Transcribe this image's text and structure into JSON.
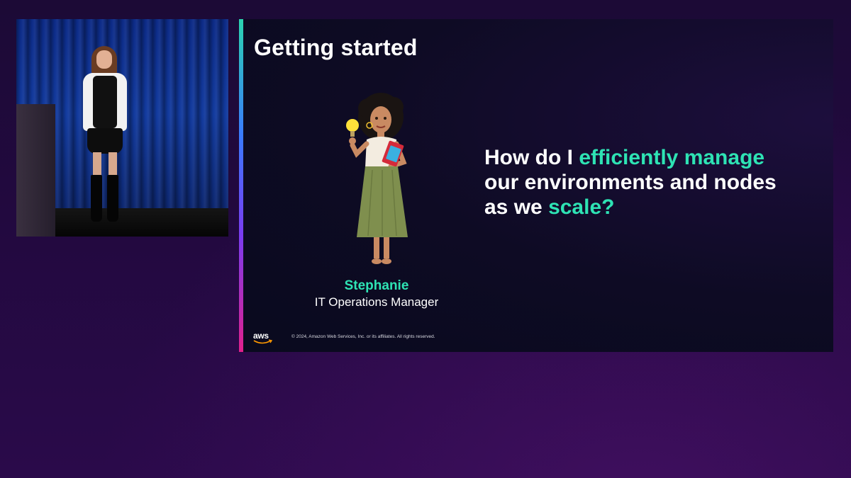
{
  "slide": {
    "title": "Getting started",
    "persona": {
      "name": "Stephanie",
      "role": "IT Operations Manager"
    },
    "question": {
      "line1_prefix": "How do I ",
      "line1_highlight": "efficiently manage",
      "line2": "our environments and nodes",
      "line3_prefix": "as we ",
      "line3_highlight": "scale?"
    },
    "logo_text": "aws",
    "copyright": "© 2024, Amazon Web Services, Inc. or its affiliates. All rights reserved."
  },
  "colors": {
    "accent_teal": "#2ee3b4",
    "background_purple": "#22093f",
    "slide_background": "#0e0b24"
  },
  "icons": {
    "persona": "woman-with-lightbulb-illustration",
    "brand": "aws-logo"
  }
}
